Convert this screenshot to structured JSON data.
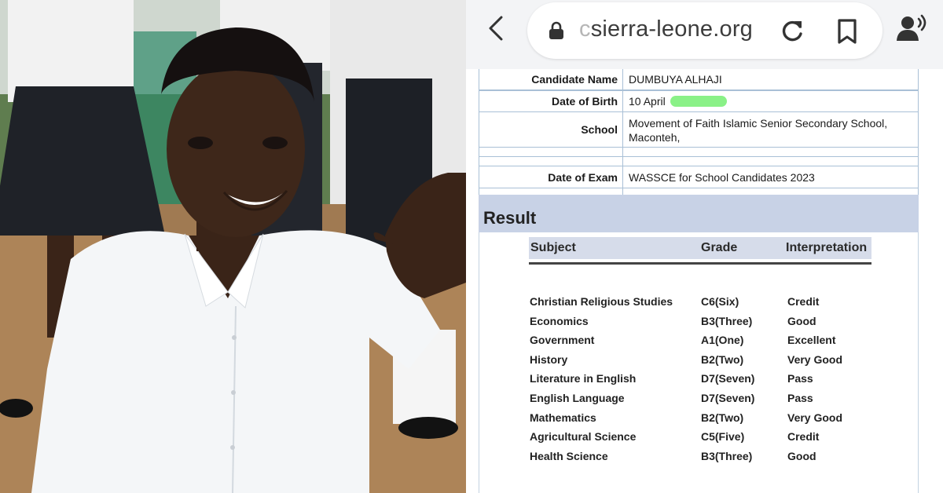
{
  "browser": {
    "url_prefix": "c",
    "url_text": "sierra-leone.org",
    "icons": [
      "chevron-left-icon",
      "lock-icon",
      "reload-icon",
      "bookmark-icon",
      "voice-icon"
    ]
  },
  "candidate": {
    "name_label": "Candidate Name",
    "name_value": "DUMBUYA ALHAJI",
    "dob_label": "Date of Birth",
    "dob_value": "10 April",
    "school_label": "School",
    "school_line1": "Movement of Faith Islamic Senior Secondary School,",
    "school_line2": "Maconteh,",
    "exam_label": "Date of Exam",
    "exam_value": "WASSCE for School Candidates 2023"
  },
  "result": {
    "title": "Result",
    "headers": {
      "subject": "Subject",
      "grade": "Grade",
      "interpretation": "Interpretation"
    },
    "rows": [
      {
        "subject": "Christian Religious Studies",
        "grade": "C6(Six)",
        "interpretation": "Credit"
      },
      {
        "subject": "Economics",
        "grade": "B3(Three)",
        "interpretation": "Good"
      },
      {
        "subject": "Government",
        "grade": "A1(One)",
        "interpretation": "Excellent"
      },
      {
        "subject": "History",
        "grade": "B2(Two)",
        "interpretation": "Very Good"
      },
      {
        "subject": "Literature in English",
        "grade": "D7(Seven)",
        "interpretation": "Pass"
      },
      {
        "subject": "English Language",
        "grade": "D7(Seven)",
        "interpretation": "Pass"
      },
      {
        "subject": "Mathematics",
        "grade": "B2(Two)",
        "interpretation": "Very Good"
      },
      {
        "subject": "Agricultural Science",
        "grade": "C5(Five)",
        "interpretation": "Credit"
      },
      {
        "subject": "Health Science",
        "grade": "B3(Three)",
        "interpretation": "Good"
      }
    ]
  },
  "colors": {
    "table_border": "#a9c0d6",
    "result_band": "#c8d2e6",
    "header_band": "#d6dcea",
    "redaction_highlight": "#7df07a"
  }
}
